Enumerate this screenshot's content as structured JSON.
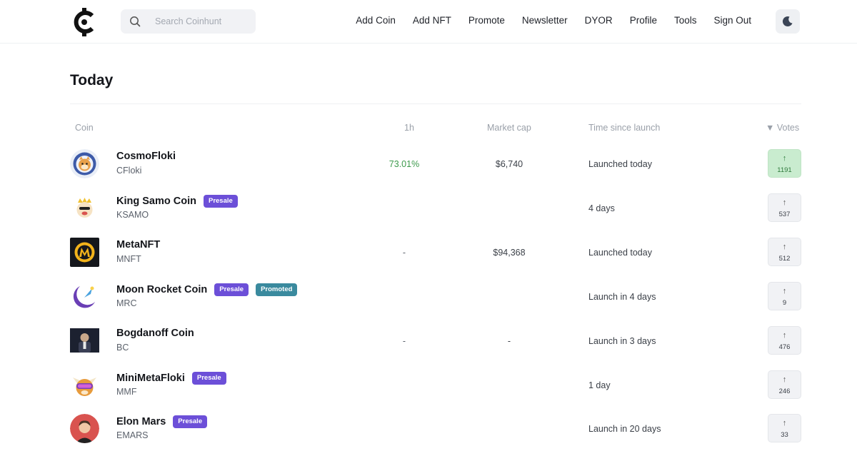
{
  "search": {
    "placeholder": "Search Coinhunt"
  },
  "nav": {
    "links": [
      "Add Coin",
      "Add NFT",
      "Promote",
      "Newsletter",
      "DYOR",
      "Profile",
      "Tools",
      "Sign Out"
    ]
  },
  "page": {
    "title": "Today"
  },
  "table": {
    "headers": {
      "coin": "Coin",
      "h1": "1h",
      "mcap": "Market cap",
      "time": "Time since launch",
      "votes": "▼ Votes"
    },
    "rows": [
      {
        "name": "CosmoFloki",
        "symbol": "CFloki",
        "badges": [],
        "h1": "73.01%",
        "mcap": "$6,740",
        "time": "Launched today",
        "votes": "1191",
        "voted": true
      },
      {
        "name": "King Samo Coin",
        "symbol": "KSAMO",
        "badges": [
          "Presale"
        ],
        "h1": "",
        "mcap": "",
        "time": "4 days",
        "votes": "537",
        "voted": false
      },
      {
        "name": "MetaNFT",
        "symbol": "MNFT",
        "badges": [],
        "h1": "-",
        "mcap": "$94,368",
        "time": "Launched today",
        "votes": "512",
        "voted": false
      },
      {
        "name": "Moon Rocket Coin",
        "symbol": "MRC",
        "badges": [
          "Presale",
          "Promoted"
        ],
        "h1": "",
        "mcap": "",
        "time": "Launch in 4 days",
        "votes": "9",
        "voted": false
      },
      {
        "name": "Bogdanoff Coin",
        "symbol": "BC",
        "badges": [],
        "h1": "-",
        "mcap": "-",
        "time": "Launch in 3 days",
        "votes": "476",
        "voted": false
      },
      {
        "name": "MiniMetaFloki",
        "symbol": "MMF",
        "badges": [
          "Presale"
        ],
        "h1": "",
        "mcap": "",
        "time": "1 day",
        "votes": "246",
        "voted": false
      },
      {
        "name": "Elon Mars",
        "symbol": "EMARS",
        "badges": [
          "Presale"
        ],
        "h1": "",
        "mcap": "",
        "time": "Launch in 20 days",
        "votes": "33",
        "voted": false
      }
    ]
  },
  "icons": {
    "logo": "coinhunt-logo",
    "search": "search-icon",
    "theme": "moon-icon",
    "vote": "arrow-up-icon"
  },
  "colors": {
    "accent_presale": "#6c4fd8",
    "accent_promoted": "#3a8a9e",
    "positive": "#3d9a4c",
    "voted_bg": "#c9eccf"
  }
}
